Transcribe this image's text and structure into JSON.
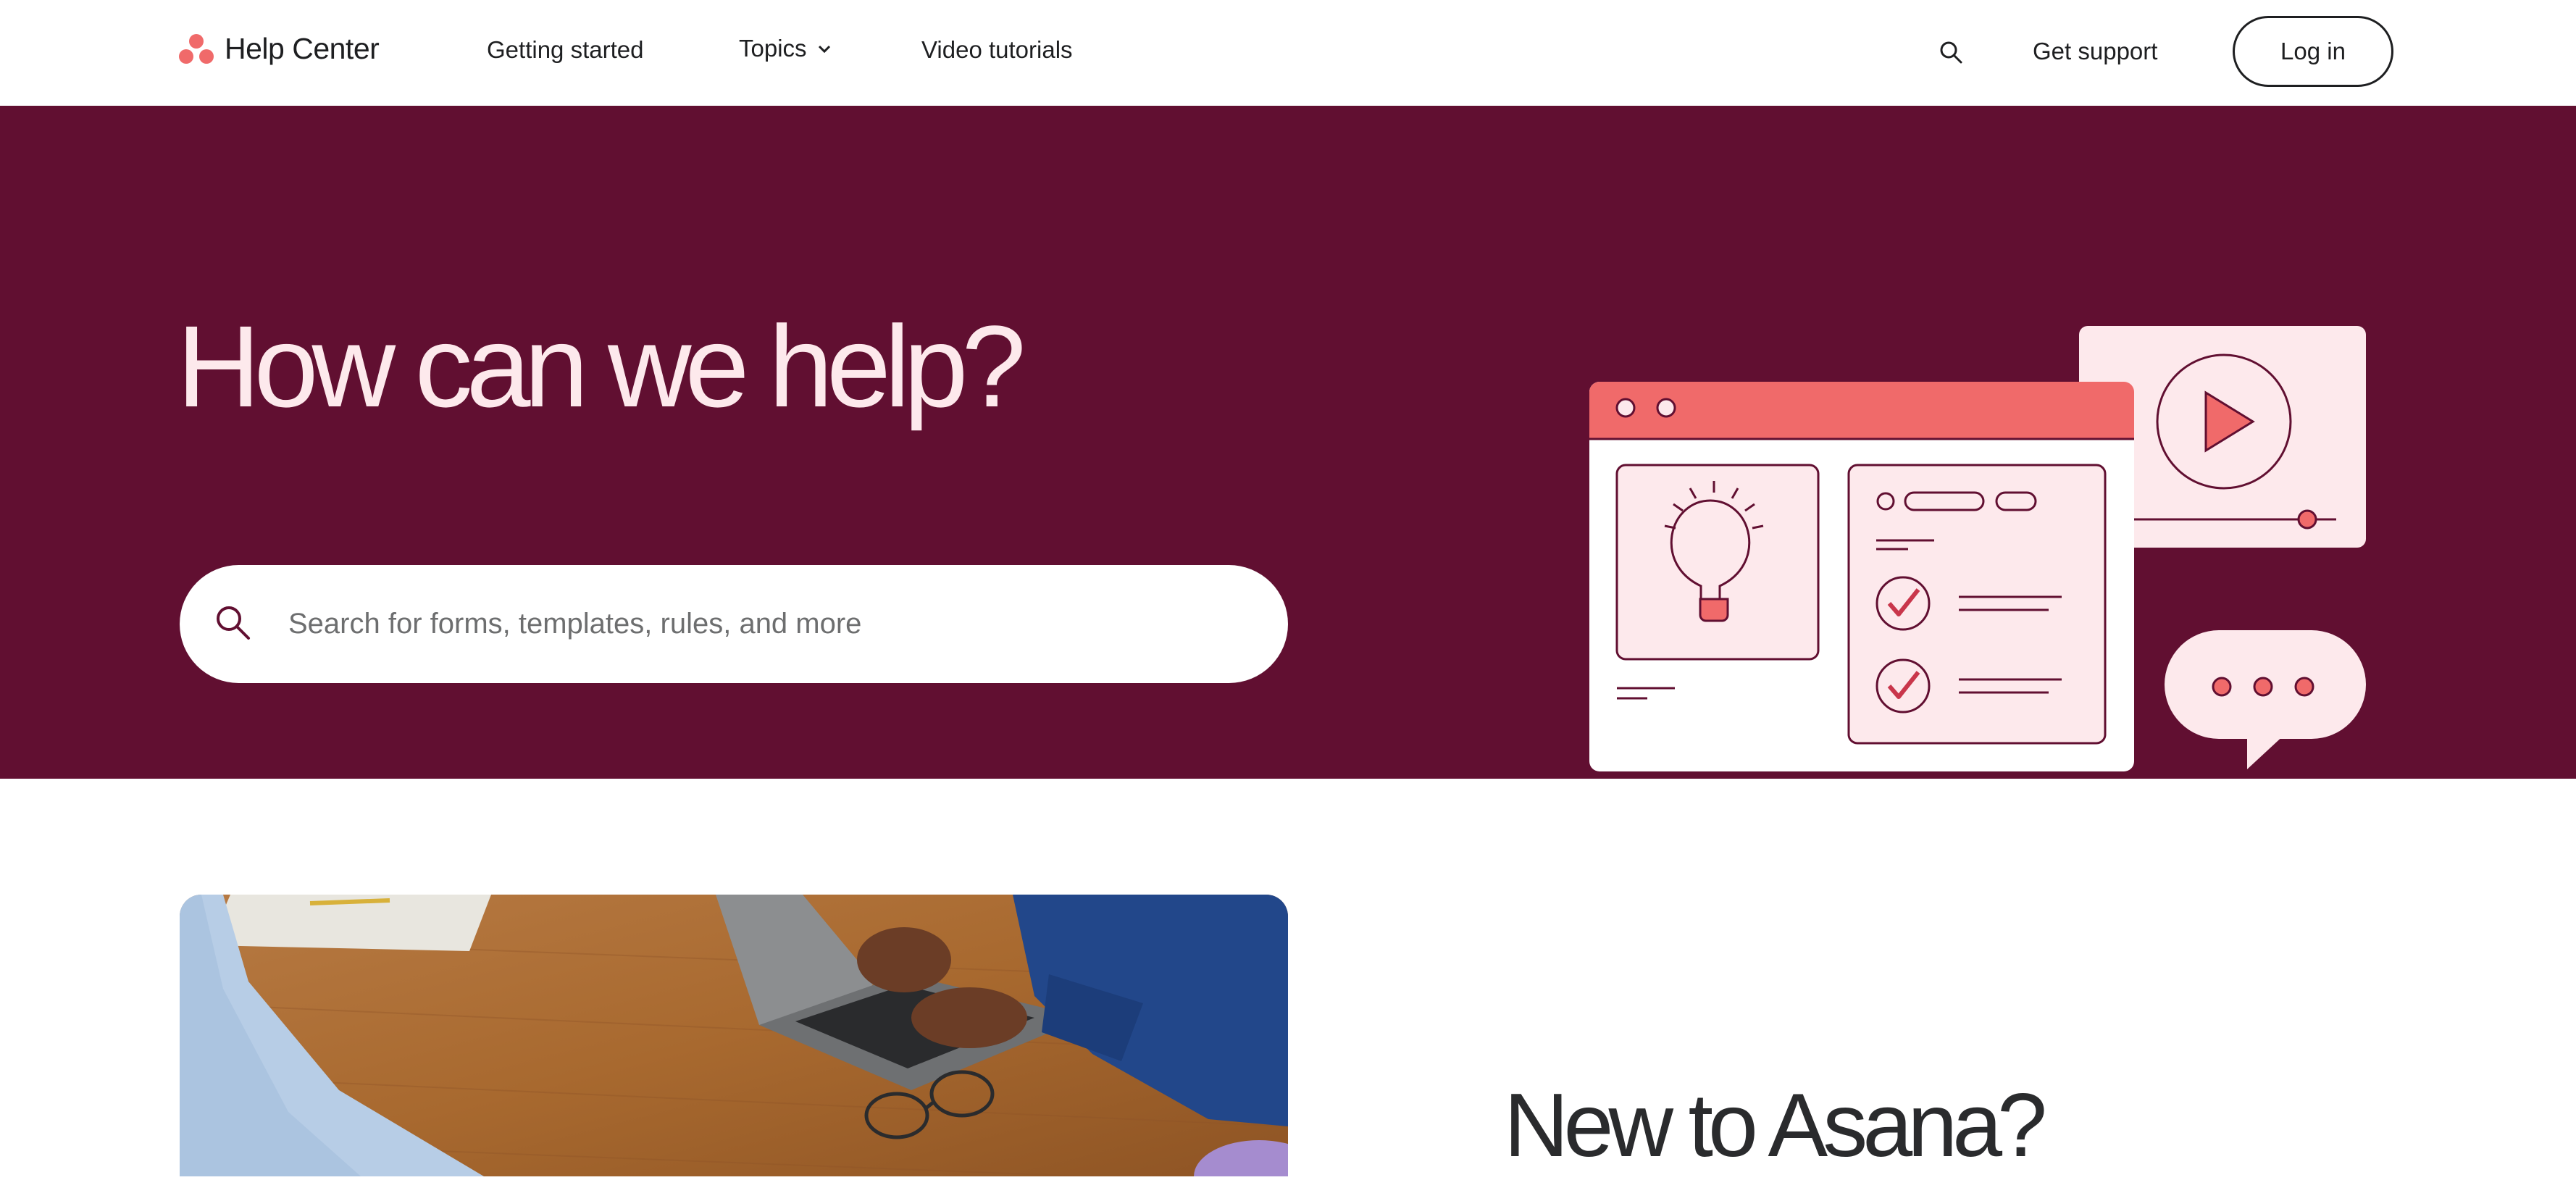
{
  "brand": {
    "name": "Help Center",
    "logo_icon": "asana-three-dots-logo",
    "logo_color": "#f06a6a"
  },
  "nav": {
    "links": [
      "Getting started",
      "Topics",
      "Video tutorials"
    ],
    "search_icon": "search-icon",
    "get_support": "Get support",
    "login": "Log in"
  },
  "hero": {
    "title": "How can we help?",
    "search_placeholder": "Search for forms, templates, rules, and more",
    "background": "#610f31",
    "title_color": "#fde9ec",
    "illustration_icons": [
      "browser-window-illustration",
      "lightbulb-icon",
      "checklist-icon",
      "play-video-icon",
      "chat-bubble-icon"
    ]
  },
  "intro": {
    "heading": "New to Asana?",
    "photo_icon": "people-working-at-laptop-photo"
  },
  "colors": {
    "accent": "#f06a6a",
    "light_pink": "#fde9ec",
    "dark": "#1e1f21",
    "outline": "#610f31"
  }
}
